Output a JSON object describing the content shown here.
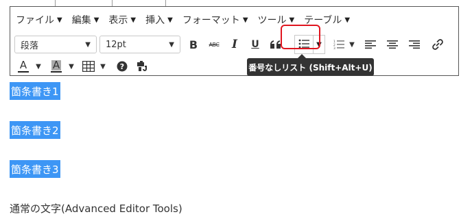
{
  "menubar": {
    "items": [
      {
        "label": "ファイル"
      },
      {
        "label": "編集"
      },
      {
        "label": "表示"
      },
      {
        "label": "挿入"
      },
      {
        "label": "フォーマット"
      },
      {
        "label": "ツール"
      },
      {
        "label": "テーブル"
      }
    ]
  },
  "toolbar": {
    "block_format": "段落",
    "font_size": "12pt",
    "buttons": {
      "bold": "B",
      "strikethrough": "ABC",
      "italic": "I",
      "underline": "U",
      "blockquote": "66"
    },
    "text_color_label": "A",
    "bg_color_label": "A"
  },
  "tooltip": {
    "text": "番号なしリスト (Shift+Alt+U)"
  },
  "content": {
    "selected_lines": [
      "箇条書き1",
      "箇条書き2",
      "箇条書き3"
    ],
    "plain_line": "通常の文字(Advanced Editor Tools)"
  },
  "colors": {
    "selection": "#3d96f5",
    "highlight_ring": "#e0141e",
    "tooltip_bg": "#333333"
  }
}
